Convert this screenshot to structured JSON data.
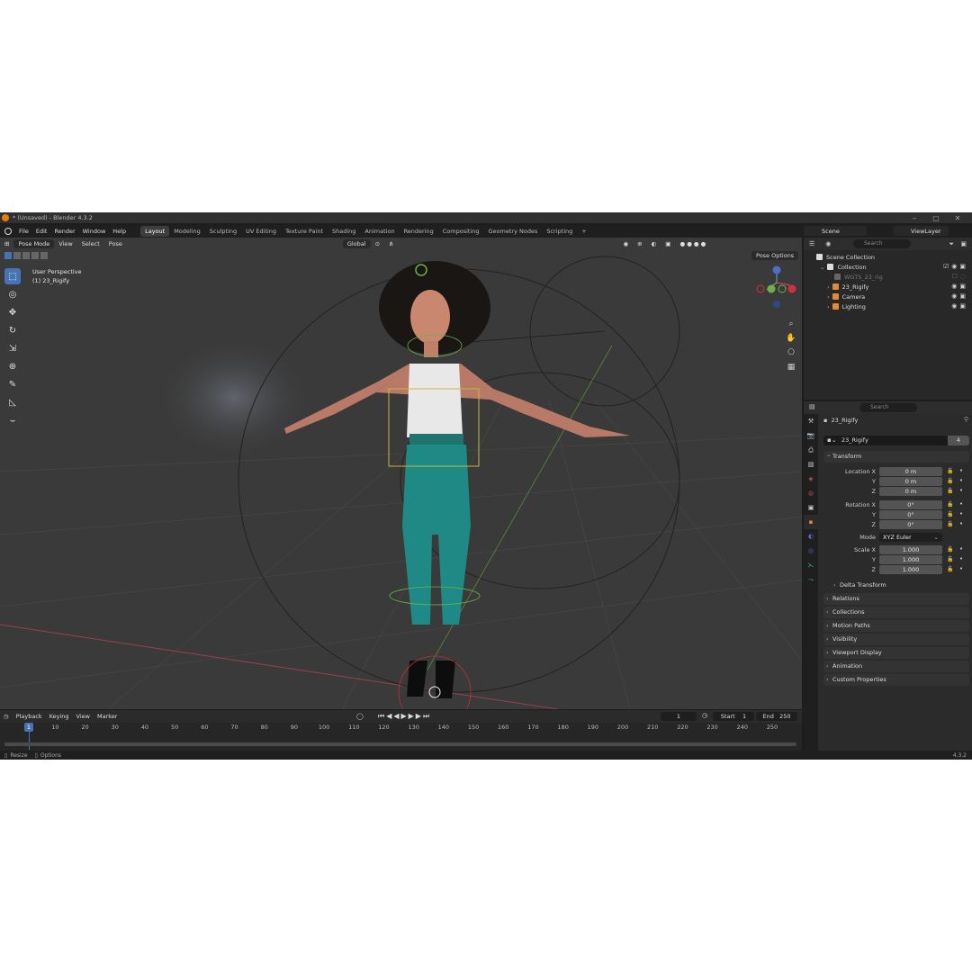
{
  "window": {
    "title": "* (Unsaved) - Blender 4.3.2"
  },
  "menu": {
    "items": [
      "File",
      "Edit",
      "Render",
      "Window",
      "Help"
    ],
    "workspaces": [
      "Layout",
      "Modeling",
      "Sculpting",
      "UV Editing",
      "Texture Paint",
      "Shading",
      "Animation",
      "Rendering",
      "Compositing",
      "Geometry Nodes",
      "Scripting"
    ],
    "active_workspace": "Layout",
    "add_tab": "+",
    "scene": "Scene",
    "view_layer": "ViewLayer"
  },
  "viewport": {
    "mode": "Pose Mode",
    "menus": [
      "View",
      "Select",
      "Pose"
    ],
    "transform_orientation": "Global",
    "pose_options": "Pose Options",
    "overlay_line1": "User Perspective",
    "overlay_line2": "(1) 23_Rigify",
    "tools": [
      "select-box",
      "cursor",
      "move",
      "rotate",
      "scale",
      "transform",
      "annotate",
      "measure",
      "bone-relax"
    ],
    "active_tool": "select-box"
  },
  "timeline": {
    "menus": [
      "Playback",
      "Keying",
      "View",
      "Marker"
    ],
    "current_frame": "1",
    "start_label": "Start",
    "start": "1",
    "end_label": "End",
    "end": "250",
    "ruler": [
      "10",
      "20",
      "30",
      "40",
      "50",
      "60",
      "70",
      "80",
      "90",
      "100",
      "110",
      "120",
      "130",
      "140",
      "150",
      "160",
      "170",
      "180",
      "190",
      "200",
      "210",
      "220",
      "230",
      "240",
      "250"
    ],
    "marker_label": "1"
  },
  "statusbar": {
    "left1": "Resize",
    "left2": "Options",
    "version": "4.3.2"
  },
  "outliner": {
    "search_placeholder": "Search",
    "rows": [
      {
        "label": "Scene Collection",
        "dim": false
      },
      {
        "label": "Collection",
        "dim": false
      },
      {
        "label": "WGTS_23_rig",
        "dim": true
      },
      {
        "label": "23_Rigify",
        "dim": false
      },
      {
        "label": "Camera",
        "dim": false
      },
      {
        "label": "Lighting",
        "dim": false
      }
    ]
  },
  "properties": {
    "search_placeholder": "Search",
    "object_name": "23_Rigify",
    "data_name": "23_Rigify",
    "data_users": "4",
    "transform_header": "Transform",
    "location_label": "Location X",
    "location": [
      "0 m",
      "0 m",
      "0 m"
    ],
    "rotation_label": "Rotation X",
    "rotation": [
      "0°",
      "0°",
      "0°"
    ],
    "mode_label": "Mode",
    "mode_value": "XYZ Euler",
    "scale_label": "Scale X",
    "scale": [
      "1.000",
      "1.000",
      "1.000"
    ],
    "axis_y": "Y",
    "axis_z": "Z",
    "delta_transform": "Delta Transform",
    "panels": [
      "Relations",
      "Collections",
      "Motion Paths",
      "Visibility",
      "Viewport Display",
      "Animation",
      "Custom Properties"
    ]
  }
}
